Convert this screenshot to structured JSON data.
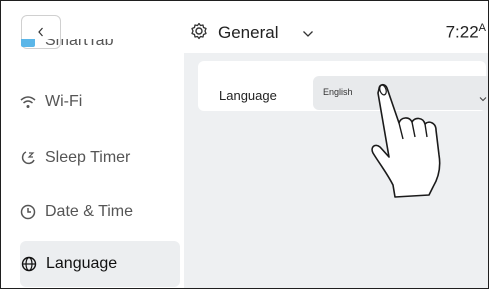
{
  "header": {
    "title": "General",
    "time": "7:22",
    "time_suffix": "A"
  },
  "sidebar": {
    "items": [
      {
        "label": "SmartTab",
        "icon": "smarttab-icon"
      },
      {
        "label": "Wi-Fi",
        "icon": "wifi-icon"
      },
      {
        "label": "Sleep Timer",
        "icon": "sleep-timer-icon"
      },
      {
        "label": "Date & Time",
        "icon": "clock-icon"
      },
      {
        "label": "Language",
        "icon": "globe-icon",
        "active": true
      }
    ]
  },
  "main": {
    "setting_label": "Language",
    "select_value": "English"
  },
  "colors": {
    "content_bg": "#eef0f2",
    "active_item_bg": "#eceef0",
    "smarttab_icon": "#5bb6e8"
  }
}
